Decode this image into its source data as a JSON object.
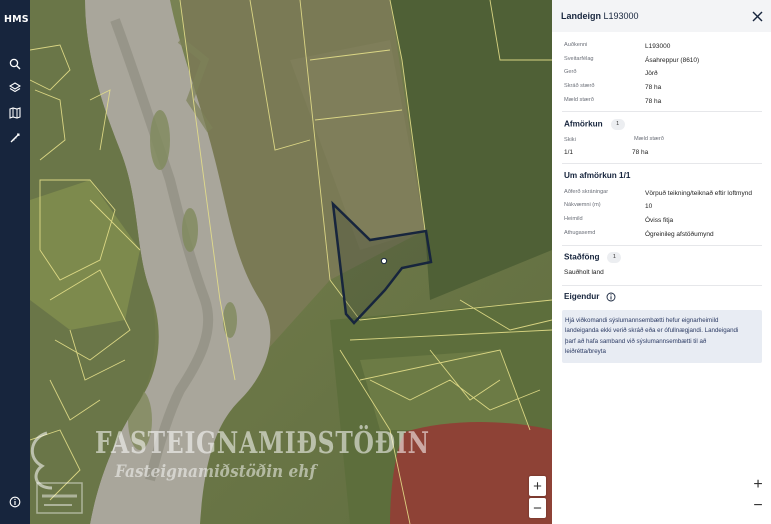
{
  "nav": {
    "logo": "HMS",
    "icons": [
      "search-icon",
      "layers-icon",
      "map-book-icon",
      "ruler-icon",
      "info-icon"
    ]
  },
  "map": {
    "watermark_title": "FASTEIGNAMIÐSTÖÐIN",
    "watermark_subtitle": "Fasteignamiðstöðin ehf",
    "zoom_in": "+",
    "zoom_out": "−",
    "selected_parcel_color": "#17253d",
    "parcel_line_color": "#e6e08a"
  },
  "panel": {
    "title_prefix": "Landeign",
    "title_id": "L193000",
    "zoom_in": "+",
    "zoom_out": "−",
    "fields": [
      {
        "label": "Auðkenni",
        "value": "L193000"
      },
      {
        "label": "Sveitarfélag",
        "value": "Ásahreppur (8610)"
      },
      {
        "label": "Gerð",
        "value": "Jörð"
      },
      {
        "label": "Skráð stærð",
        "value": "78 ha"
      },
      {
        "label": "Mæld stærð",
        "value": "78 ha"
      }
    ],
    "afmorkun": {
      "title": "Afmörkun",
      "count": "1",
      "col1_label": "Skiki",
      "col2_label": "Mæld stærð",
      "col1_value": "1/1",
      "col2_value": "78 ha"
    },
    "um_afmorkun": {
      "title": "Um afmörkun 1/1",
      "fields": [
        {
          "label": "Aðferð skráningar",
          "value": "Vörpuð teikning/teiknað eftir loftmynd"
        },
        {
          "label": "Nákvæmni (m)",
          "value": "10"
        },
        {
          "label": "Heimild",
          "value": "Óviss fitja"
        },
        {
          "label": "Athugasemd",
          "value": "Ógreinileg afstöðumynd"
        }
      ]
    },
    "stadfong": {
      "title": "Staðföng",
      "count": "1",
      "item": "Sauðholt land"
    },
    "eigendur": {
      "title": "Eigendur",
      "info_lines": [
        "Hjá viðkomandi sýslumannsembætti hefur eignarheimild",
        "landeiganda ekki verið skráð eða er ófullnægjandi. Landeigandi",
        "þarf að hafa samband við sýslumannsembætti til að",
        "leiðrétta/breyta"
      ]
    }
  }
}
